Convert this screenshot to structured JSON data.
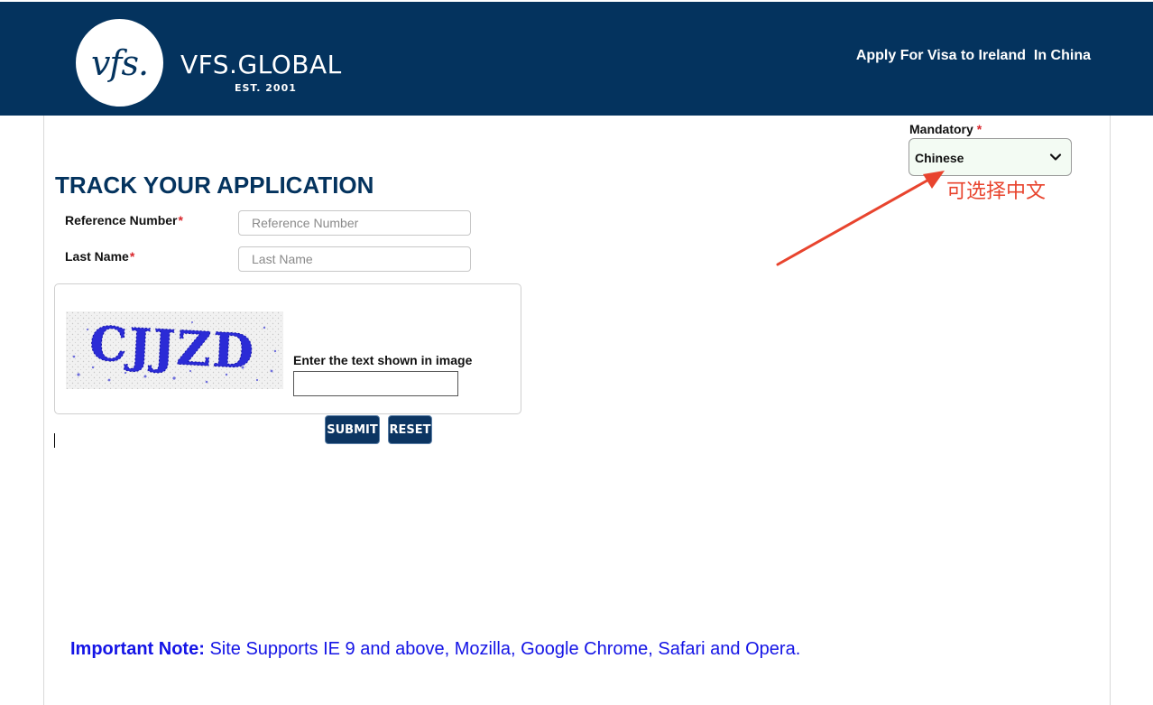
{
  "header": {
    "logo_mark": "vfs.",
    "logo_word": "VFS.GLOBAL",
    "logo_est": "EST. 2001",
    "title": "Apply For Visa to Ireland  In China"
  },
  "language": {
    "label": "Mandatory",
    "required_marker": "*",
    "selected": "Chinese",
    "annotation": "可选择中文",
    "annotation_color": "#e8442e"
  },
  "form": {
    "title": "TRACK YOUR APPLICATION",
    "reference_label": "Reference Number",
    "reference_placeholder": "Reference Number",
    "lastname_label": "Last Name",
    "lastname_placeholder": "Last Name",
    "required_marker": "*",
    "captcha_text": "CJJZD",
    "captcha_label": "Enter the text shown in image",
    "submit_label": "SUBMIT",
    "reset_label": "RESET"
  },
  "note": {
    "prefix": "Important Note:",
    "text": " Site Supports IE 9 and above, Mozilla, Google Chrome, Safari and Opera."
  },
  "colors": {
    "header_bg": "#04335e",
    "button_bg": "#0c3562",
    "note_color": "#1414e6"
  }
}
